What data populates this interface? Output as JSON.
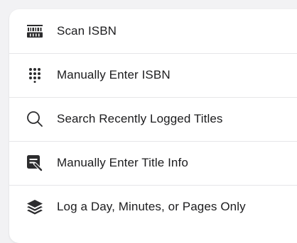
{
  "menu": {
    "items": [
      {
        "label": "Scan ISBN",
        "icon": "barcode-scan-icon"
      },
      {
        "label": "Manually Enter ISBN",
        "icon": "keypad-icon"
      },
      {
        "label": "Search Recently Logged Titles",
        "icon": "search-icon"
      },
      {
        "label": "Manually Enter Title Info",
        "icon": "edit-document-icon"
      },
      {
        "label": "Log a Day, Minutes, or Pages Only",
        "icon": "layers-icon"
      }
    ]
  },
  "colors": {
    "text": "#1c1c1e",
    "icon": "#2c2c2e",
    "divider": "#e6e6e8",
    "background": "#ffffff"
  }
}
